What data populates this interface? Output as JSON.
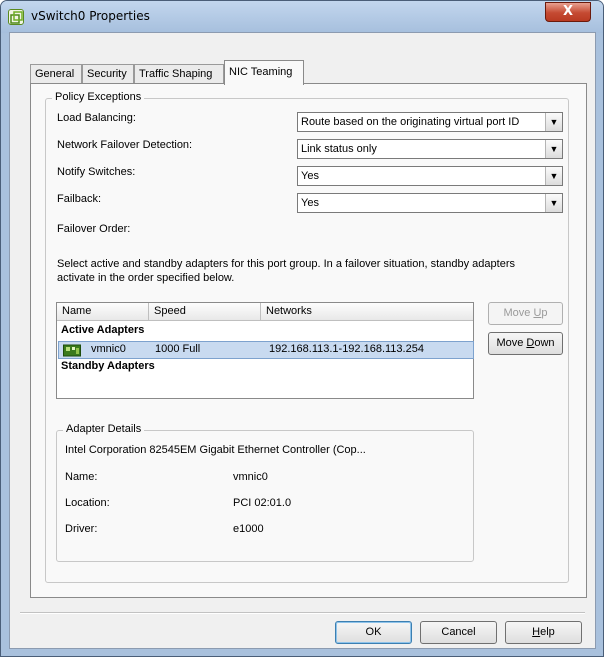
{
  "window": {
    "title": "vSwitch0 Properties",
    "close_glyph": "X",
    "app_icon": "vsphere-icon"
  },
  "tabs": [
    {
      "label": "General"
    },
    {
      "label": "Security"
    },
    {
      "label": "Traffic Shaping"
    },
    {
      "label": "NIC Teaming",
      "active": true
    }
  ],
  "policy": {
    "title": "Policy Exceptions",
    "load_balancing_label": "Load Balancing:",
    "load_balancing_value": "Route based on the originating virtual port ID",
    "failover_detection_label": "Network Failover Detection:",
    "failover_detection_value": "Link status only",
    "notify_label": "Notify Switches:",
    "notify_value": "Yes",
    "failback_label": "Failback:",
    "failback_value": "Yes",
    "failover_order_label": "Failover Order:",
    "description": "Select active and standby adapters for this port group.  In a failover situation, standby adapters activate  in the order specified below."
  },
  "adapter_list": {
    "columns": [
      "Name",
      "Speed",
      "Networks"
    ],
    "active_header": "Active Adapters",
    "standby_header": "Standby Adapters",
    "active_rows": [
      {
        "icon": "nic-icon",
        "name": "vmnic0",
        "speed": "1000 Full",
        "networks": "192.168.113.1-192.168.113.254"
      }
    ]
  },
  "move_up_label": {
    "before": "Move ",
    "key": "U",
    "after": "p"
  },
  "move_down_label": {
    "before": "Move ",
    "key": "D",
    "after": "own"
  },
  "adapter_details": {
    "title": "Adapter Details",
    "description": "Intel Corporation 82545EM Gigabit Ethernet Controller (Cop...",
    "name_label": "Name:",
    "name_value": "vmnic0",
    "location_label": "Location:",
    "location_value": "PCI 02:01.0",
    "driver_label": "Driver:",
    "driver_value": "e1000"
  },
  "footer": {
    "ok_label": "OK",
    "cancel_label": "Cancel",
    "help_label": {
      "key": "H",
      "after": "elp"
    }
  },
  "colors": {
    "selection": "#c8daf0",
    "title_gradient": "#a6bfdd",
    "close_button": "#c54a32"
  }
}
